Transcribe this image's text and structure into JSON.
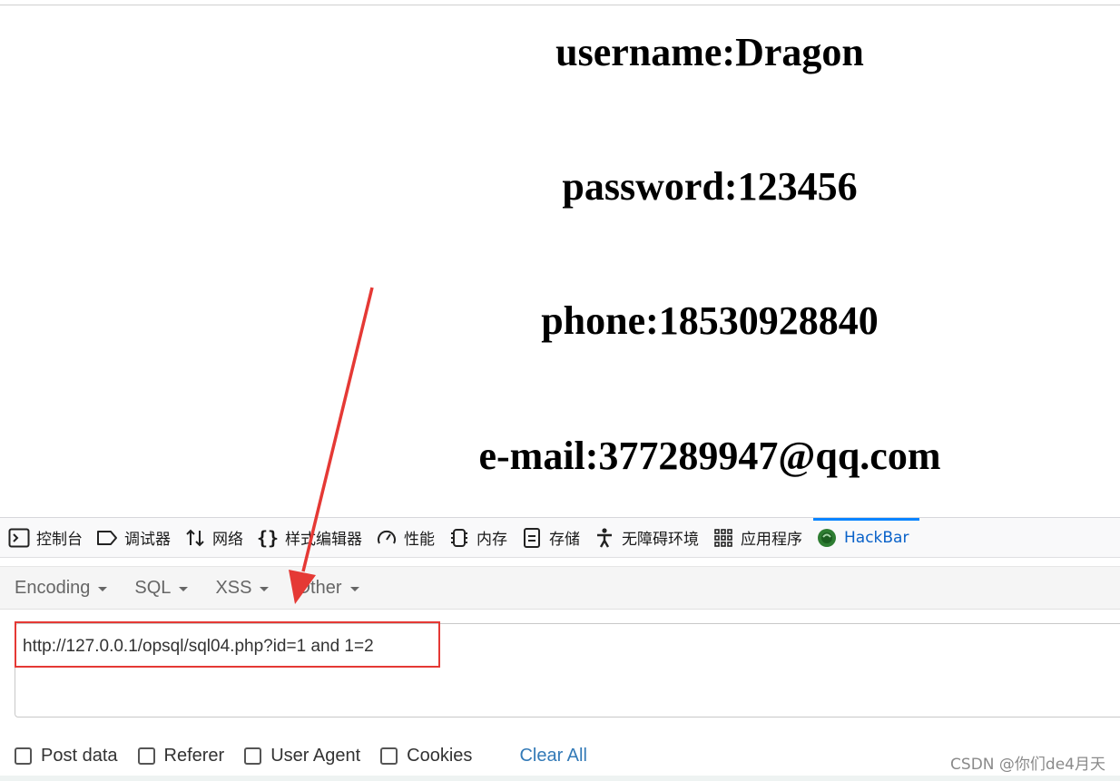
{
  "page": {
    "lines": [
      "username:Dragon",
      "password:123456",
      "phone:18530928840",
      "e-mail:377289947@qq.com"
    ]
  },
  "devtools": {
    "tabs": [
      {
        "label": "控制台",
        "icon": "console-icon"
      },
      {
        "label": "调试器",
        "icon": "debugger-icon"
      },
      {
        "label": "网络",
        "icon": "network-icon"
      },
      {
        "label": "样式编辑器",
        "icon": "style-editor-icon"
      },
      {
        "label": "性能",
        "icon": "performance-icon"
      },
      {
        "label": "内存",
        "icon": "memory-icon"
      },
      {
        "label": "存储",
        "icon": "storage-icon"
      },
      {
        "label": "无障碍环境",
        "icon": "accessibility-icon"
      },
      {
        "label": "应用程序",
        "icon": "application-icon"
      },
      {
        "label": "HackBar",
        "icon": "hackbar-icon",
        "active": true
      }
    ],
    "accent": "#0a84ff"
  },
  "hackbar": {
    "menus": [
      "Encoding",
      "SQL",
      "XSS",
      "Other"
    ],
    "url": "http://127.0.0.1/opsql/sql04.php?id=1 and 1=2",
    "options": [
      "Post data",
      "Referer",
      "User Agent",
      "Cookies"
    ],
    "clear_all": "Clear All"
  },
  "annotation": {
    "color": "#e53935"
  },
  "watermark": "CSDN @你们de4月天"
}
